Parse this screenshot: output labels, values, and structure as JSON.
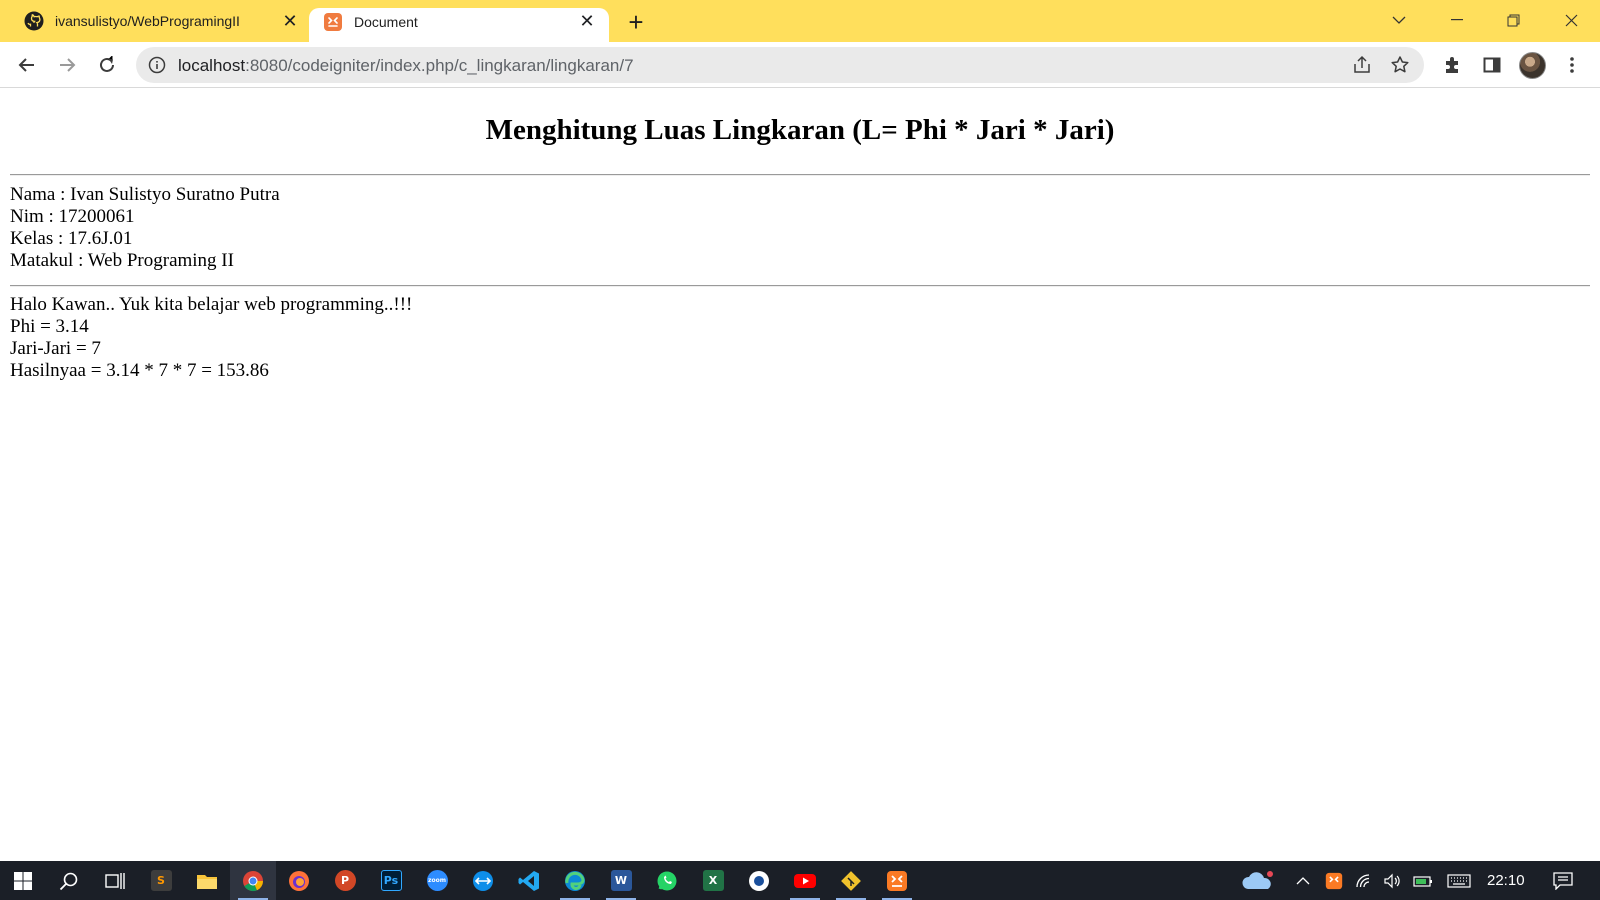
{
  "browser": {
    "tabs": [
      {
        "title": "ivansulistyo/WebProgramingII",
        "favicon": "github-icon",
        "active": false
      },
      {
        "title": "Document",
        "favicon": "codeigniter-icon",
        "active": true
      }
    ],
    "url_host": "localhost",
    "url_path": ":8080/codeigniter/index.php/c_lingkaran/lingkaran/7",
    "accent_color": "#ffdf5c"
  },
  "page": {
    "heading": "Menghitung Luas Lingkaran (L= Phi * Jari * Jari)",
    "student": {
      "nama": "Nama : Ivan Sulistyo Suratno Putra",
      "nim": "Nim : 17200061",
      "kelas": "Kelas : 17.6J.01",
      "matakul": "Matakul : Web Programing II"
    },
    "result": {
      "greeting": "Halo Kawan.. Yuk kita belajar web programming..!!!",
      "phi": "Phi = 3.14",
      "jari": "Jari-Jari = 7",
      "hasil": "Hasilnyaa = 3.14 * 7 * 7 = 153.86"
    }
  },
  "taskbar": {
    "clock": "22:10",
    "apps": [
      "windows-start-icon",
      "search-icon",
      "task-view-icon",
      "sublime-text-icon",
      "file-explorer-icon",
      "chrome-icon",
      "firefox-icon",
      "powerpoint-icon",
      "photoshop-icon",
      "zoom-icon",
      "teamviewer-icon",
      "vscode-icon",
      "edge-icon",
      "word-icon",
      "whatsapp-icon",
      "excel-icon",
      "app-icon",
      "youtube-icon",
      "git-icon",
      "xampp-icon"
    ],
    "zoom_label": "zoom"
  }
}
